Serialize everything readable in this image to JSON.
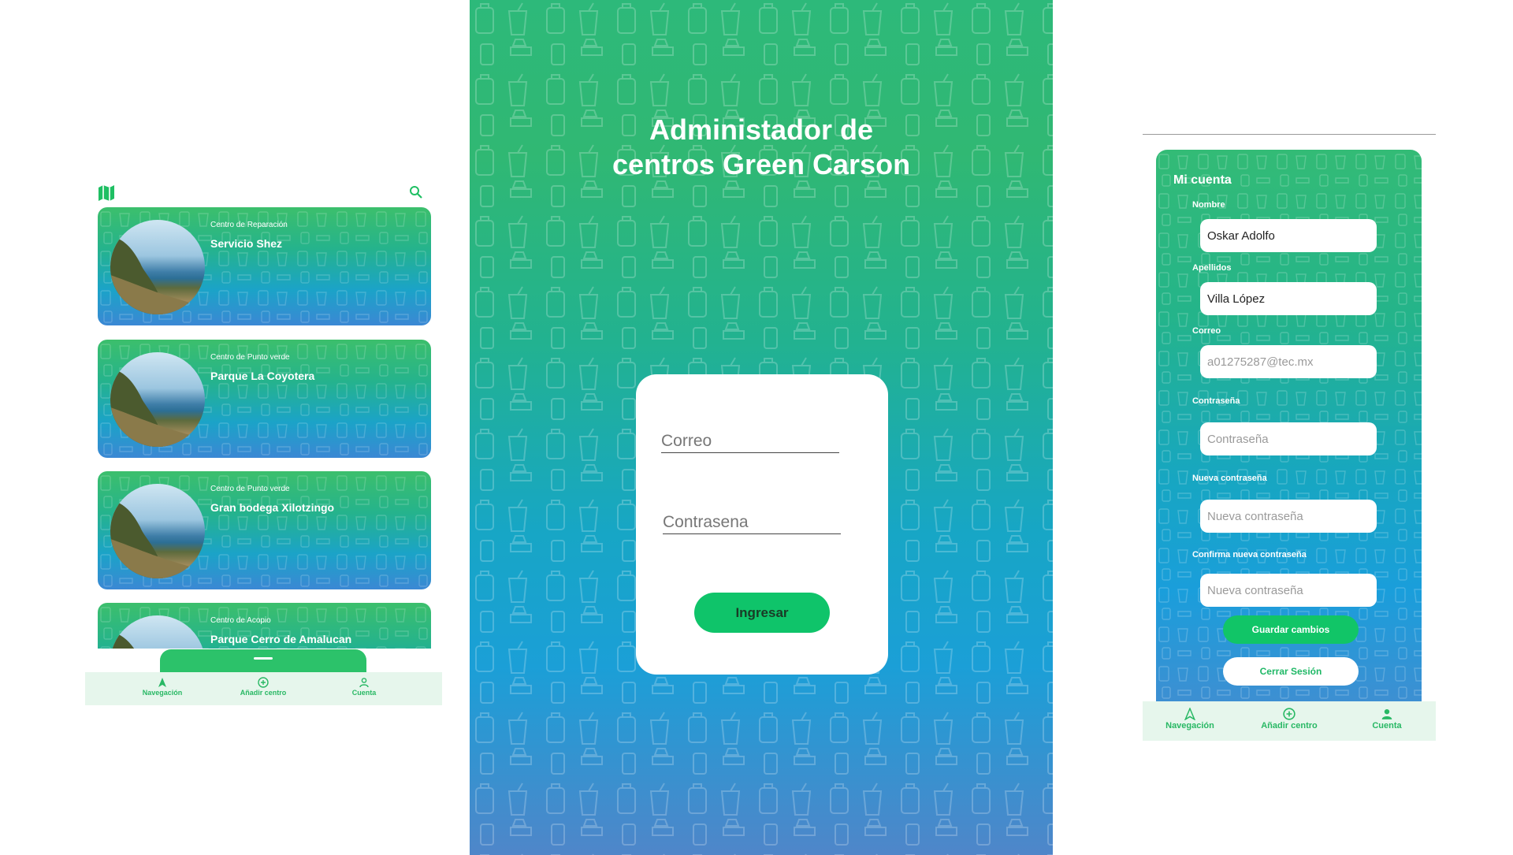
{
  "list_screen": {
    "header": {
      "map_icon": "map-icon",
      "search_icon": "search-icon"
    },
    "centers": [
      {
        "type": "Centro de Reparación",
        "name": "Servicio Shez"
      },
      {
        "type": "Centro de Punto verde",
        "name": "Parque La Coyotera"
      },
      {
        "type": "Centro de Punto verde",
        "name": "Gran bodega Xilotzingo"
      },
      {
        "type": "Centro de Acopio",
        "name": "Parque Cerro de Amalucan"
      }
    ],
    "bottom_nav": [
      {
        "label": "Navegación",
        "icon": "navigation-arrow-icon"
      },
      {
        "label": "Añadir centro",
        "icon": "add-circle-icon"
      },
      {
        "label": "Cuenta",
        "icon": "person-icon"
      }
    ]
  },
  "login_screen": {
    "title_line1": "Administador de",
    "title_line2": "centros Green Carson",
    "email_placeholder": "Correo",
    "password_placeholder": "Contrasena",
    "submit_label": "Ingresar"
  },
  "account_screen": {
    "title": "Mi cuenta",
    "fields": {
      "nombre_label": "Nombre",
      "nombre_value": "Oskar Adolfo",
      "apellidos_label": "Apellidos",
      "apellidos_value": "Villa López",
      "correo_label": "Correo",
      "correo_value": "a01275287@tec.mx",
      "contrasena_label": "Contraseña",
      "contrasena_placeholder": "Contraseña",
      "nueva_label": "Nueva contraseña",
      "nueva_placeholder": "Nueva contraseña",
      "confirma_label": "Confirma nueva contraseña",
      "confirma_placeholder": "Nueva contraseña"
    },
    "save_label": "Guardar cambios",
    "logout_label": "Cerrar Sesión",
    "bottom_nav": [
      {
        "label": "Navegación",
        "icon": "navigation-arrow-icon"
      },
      {
        "label": "Añadir centro",
        "icon": "add-circle-icon"
      },
      {
        "label": "Cuenta",
        "icon": "person-icon"
      }
    ]
  },
  "colors": {
    "brand_green": "#11c567",
    "gradient_top": "#2db97a",
    "gradient_bottom": "#4f86c9",
    "nav_bg": "#e6f6ec"
  }
}
